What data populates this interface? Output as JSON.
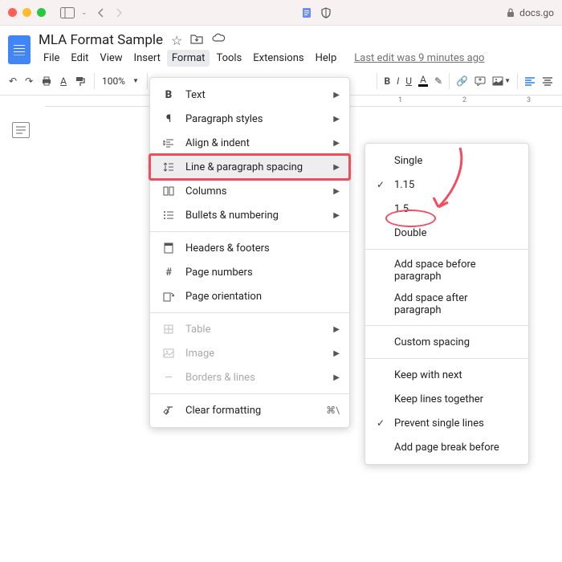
{
  "browser": {
    "url": "docs.go"
  },
  "document": {
    "title": "MLA Format Sample",
    "last_edit": "Last edit was 9 minutes ago"
  },
  "menus": [
    "File",
    "Edit",
    "View",
    "Insert",
    "Format",
    "Tools",
    "Extensions",
    "Help"
  ],
  "toolbar": {
    "zoom": "100%"
  },
  "ruler": {
    "ticks": [
      "1",
      "2",
      "3"
    ]
  },
  "format_menu": {
    "items": [
      {
        "icon": "B",
        "label": "Text",
        "arrow": true,
        "bold": true
      },
      {
        "icon": "¶",
        "label": "Paragraph styles",
        "arrow": true
      },
      {
        "icon": "align",
        "label": "Align & indent",
        "arrow": true
      },
      {
        "icon": "spacing",
        "label": "Line & paragraph spacing",
        "arrow": true,
        "highlighted": true
      },
      {
        "icon": "columns",
        "label": "Columns",
        "arrow": true
      },
      {
        "icon": "bullets",
        "label": "Bullets & numbering",
        "arrow": true
      },
      {
        "divider": true
      },
      {
        "icon": "header",
        "label": "Headers & footers"
      },
      {
        "icon": "hash",
        "label": "Page numbers"
      },
      {
        "icon": "orient",
        "label": "Page orientation"
      },
      {
        "divider": true
      },
      {
        "icon": "table",
        "label": "Table",
        "arrow": true,
        "disabled": true
      },
      {
        "icon": "image",
        "label": "Image",
        "arrow": true,
        "disabled": true
      },
      {
        "icon": "borders",
        "label": "Borders & lines",
        "arrow": true,
        "disabled": true
      },
      {
        "divider": true
      },
      {
        "icon": "clear",
        "label": "Clear formatting",
        "shortcut": "⌘\\"
      }
    ]
  },
  "spacing_menu": {
    "items": [
      {
        "label": "Single"
      },
      {
        "label": "1.15",
        "checked": true
      },
      {
        "label": "1.5"
      },
      {
        "label": "Double",
        "circled": true
      },
      {
        "divider": true
      },
      {
        "label": "Add space before paragraph"
      },
      {
        "label": "Add space after paragraph"
      },
      {
        "divider": true
      },
      {
        "label": "Custom spacing"
      },
      {
        "divider": true
      },
      {
        "label": "Keep with next"
      },
      {
        "label": "Keep lines together"
      },
      {
        "label": "Prevent single lines",
        "checked": true
      },
      {
        "label": "Add page break before"
      }
    ]
  }
}
